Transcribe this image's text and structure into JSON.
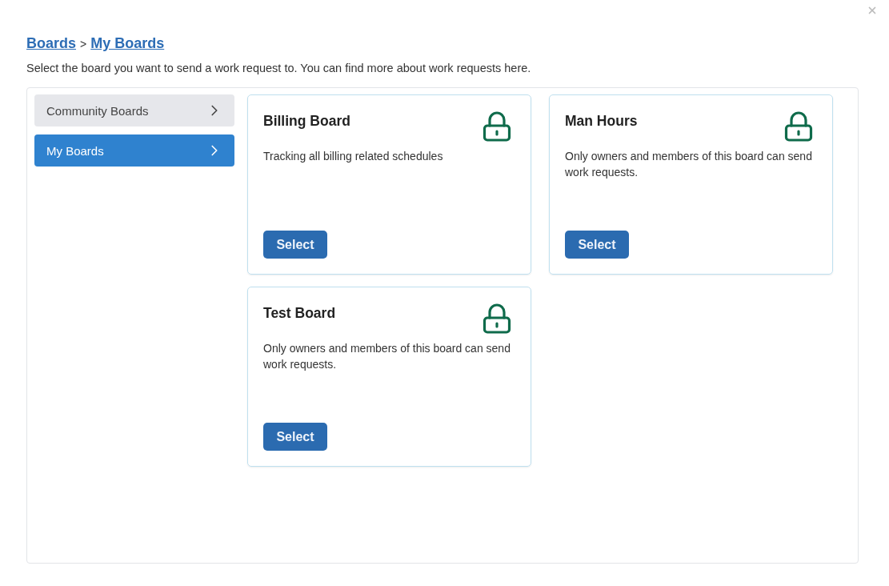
{
  "breadcrumb": [
    {
      "label": "Boards"
    },
    {
      "label": "My Boards"
    }
  ],
  "breadcrumb_separator": ">",
  "intro": {
    "text": "Select the board you want to send a work request to. You can find more about work requests ",
    "link": "here",
    "end": "."
  },
  "sidebar": {
    "items": [
      {
        "label": "Community Boards",
        "selected": false
      },
      {
        "label": "My Boards",
        "selected": true
      }
    ]
  },
  "boards": [
    {
      "title": "Billing Board",
      "description": "Tracking all billing related schedules",
      "locked": true,
      "button": "Select"
    },
    {
      "title": "Man Hours",
      "description": "Only owners and members of this board can send work requests.",
      "locked": true,
      "button": "Select"
    },
    {
      "title": "Test Board",
      "description": "Only owners and members of this board can send work requests.",
      "locked": true,
      "button": "Select"
    }
  ]
}
